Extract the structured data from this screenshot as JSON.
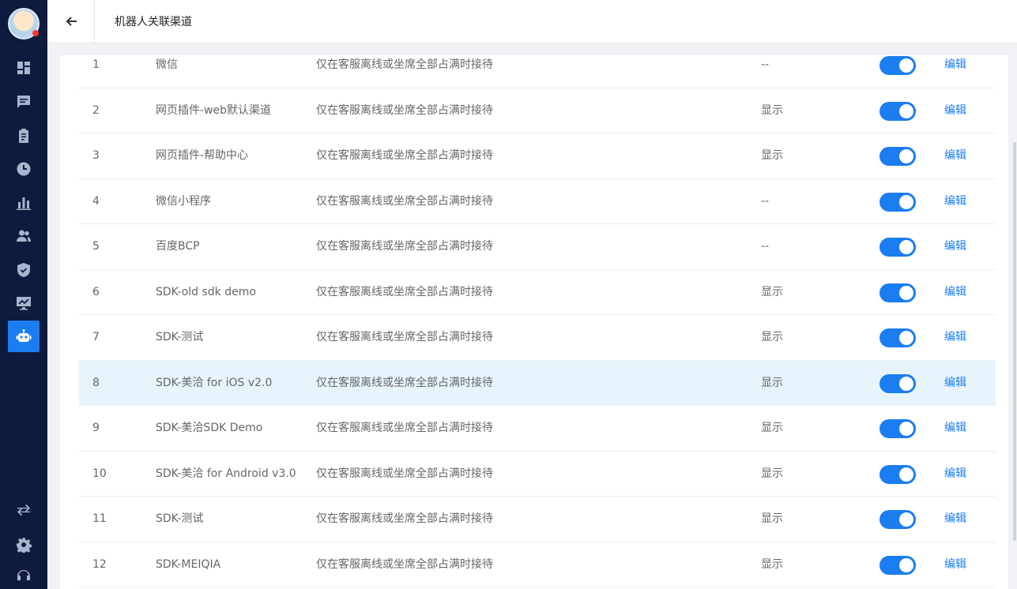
{
  "header": {
    "title": "机器人关联渠道"
  },
  "colors": {
    "accent": "#1b7df0",
    "sidebar": "#0d1b3e",
    "highlight_row": "#e8f4fc"
  },
  "sidebar": {
    "items": [
      {
        "icon": "dashboard-icon"
      },
      {
        "icon": "chat-icon"
      },
      {
        "icon": "clipboard-icon"
      },
      {
        "icon": "clock-icon"
      },
      {
        "icon": "bar-chart-icon"
      },
      {
        "icon": "users-icon"
      },
      {
        "icon": "shield-icon"
      },
      {
        "icon": "monitor-chart-icon"
      },
      {
        "icon": "robot-icon",
        "active": true
      }
    ],
    "bottom": [
      {
        "icon": "swap-icon"
      },
      {
        "icon": "gear-icon"
      },
      {
        "icon": "headset-icon"
      }
    ]
  },
  "rows": [
    {
      "index": "1",
      "name": "微信",
      "rule": "仅在客服离线或坐席全部占满时接待",
      "display": "--",
      "enabled": true,
      "action": "编辑"
    },
    {
      "index": "2",
      "name": "网页插件-web默认渠道",
      "rule": "仅在客服离线或坐席全部占满时接待",
      "display": "显示",
      "enabled": true,
      "action": "编辑"
    },
    {
      "index": "3",
      "name": "网页插件-帮助中心",
      "rule": "仅在客服离线或坐席全部占满时接待",
      "display": "显示",
      "enabled": true,
      "action": "编辑"
    },
    {
      "index": "4",
      "name": "微信小程序",
      "rule": "仅在客服离线或坐席全部占满时接待",
      "display": "--",
      "enabled": true,
      "action": "编辑"
    },
    {
      "index": "5",
      "name": "百度BCP",
      "rule": "仅在客服离线或坐席全部占满时接待",
      "display": "--",
      "enabled": true,
      "action": "编辑"
    },
    {
      "index": "6",
      "name": "SDK-old sdk demo",
      "rule": "仅在客服离线或坐席全部占满时接待",
      "display": "显示",
      "enabled": true,
      "action": "编辑"
    },
    {
      "index": "7",
      "name": "SDK-测试",
      "rule": "仅在客服离线或坐席全部占满时接待",
      "display": "显示",
      "enabled": true,
      "action": "编辑"
    },
    {
      "index": "8",
      "name": "SDK-美洽 for iOS v2.0",
      "rule": "仅在客服离线或坐席全部占满时接待",
      "display": "显示",
      "enabled": true,
      "action": "编辑",
      "highlighted": true
    },
    {
      "index": "9",
      "name": "SDK-美洽SDK Demo",
      "rule": "仅在客服离线或坐席全部占满时接待",
      "display": "显示",
      "enabled": true,
      "action": "编辑"
    },
    {
      "index": "10",
      "name": "SDK-美洽 for Android v3.0",
      "rule": "仅在客服离线或坐席全部占满时接待",
      "display": "显示",
      "enabled": true,
      "action": "编辑"
    },
    {
      "index": "11",
      "name": "SDK-测试",
      "rule": "仅在客服离线或坐席全部占满时接待",
      "display": "显示",
      "enabled": true,
      "action": "编辑"
    },
    {
      "index": "12",
      "name": "SDK-MEIQIA",
      "rule": "仅在客服离线或坐席全部占满时接待",
      "display": "显示",
      "enabled": true,
      "action": "编辑"
    }
  ]
}
